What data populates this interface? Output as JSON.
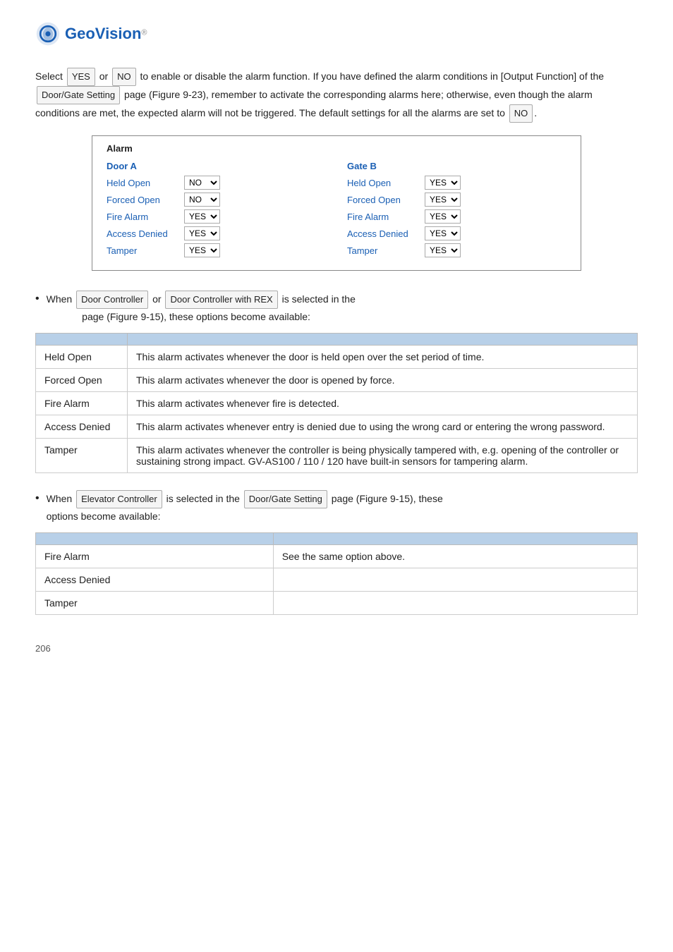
{
  "logo": {
    "text": "GeoVision",
    "trademark": "®"
  },
  "intro": {
    "para1": "Select      or      to enable or disable the alarm function. If you have defined the alarm conditions in [Output Function] of the                        page (Figure 9-23), remember to activate the corresponding alarms here; otherwise, even though the alarm conditions are met, the expected alarm will not be triggered. The default settings for all the alarms are set to     .",
    "selectLabel1": "YES",
    "selectLabel2": "NO",
    "pageRef": "Door/Gate Setting",
    "defaultVal": "NO"
  },
  "alarmBox": {
    "title": "Alarm",
    "colA": {
      "header": "Door A",
      "rows": [
        {
          "label": "Held Open",
          "value": "NO"
        },
        {
          "label": "Forced Open",
          "value": "NO"
        },
        {
          "label": "Fire Alarm",
          "value": "YES"
        },
        {
          "label": "Access Denied",
          "value": "YES"
        },
        {
          "label": "Tamper",
          "value": "YES"
        }
      ]
    },
    "colB": {
      "header": "Gate B",
      "rows": [
        {
          "label": "Held Open",
          "value": "YES"
        },
        {
          "label": "Forced Open",
          "value": "YES"
        },
        {
          "label": "Fire Alarm",
          "value": "YES"
        },
        {
          "label": "Access Denied",
          "value": "YES"
        },
        {
          "label": "Tamper",
          "value": "YES"
        }
      ]
    }
  },
  "bullet1": {
    "text_before": "When",
    "text_or": "or",
    "text_after": "is selected in the",
    "text_end": "page (Figure 9-15), these options become available:",
    "col1_header": "",
    "col2_header": "",
    "rows": [
      {
        "term": "Held Open",
        "desc": "This alarm activates whenever the door is held open over the set period of time."
      },
      {
        "term": "Forced Open",
        "desc": "This alarm activates whenever the door is opened by force."
      },
      {
        "term": "Fire Alarm",
        "desc": "This alarm activates whenever fire is detected."
      },
      {
        "term": "Access Denied",
        "desc": "This alarm activates whenever entry is denied due to using the wrong card or entering the wrong password."
      },
      {
        "term": "Tamper",
        "desc": "This alarm activates whenever the controller is being physically tampered with, e.g. opening of the controller or sustaining strong impact. GV-AS100 / 110 / 120 have built-in sensors for tampering alarm."
      }
    ]
  },
  "bullet2": {
    "text_before": "When",
    "text_middle": "is selected in the",
    "text_end": "page (Figure 9-15), these options become available:",
    "rows": [
      {
        "term": "Fire Alarm",
        "desc": "See the same option above."
      },
      {
        "term": "Access Denied",
        "desc": ""
      },
      {
        "term": "Tamper",
        "desc": ""
      }
    ]
  },
  "pageNumber": "206"
}
